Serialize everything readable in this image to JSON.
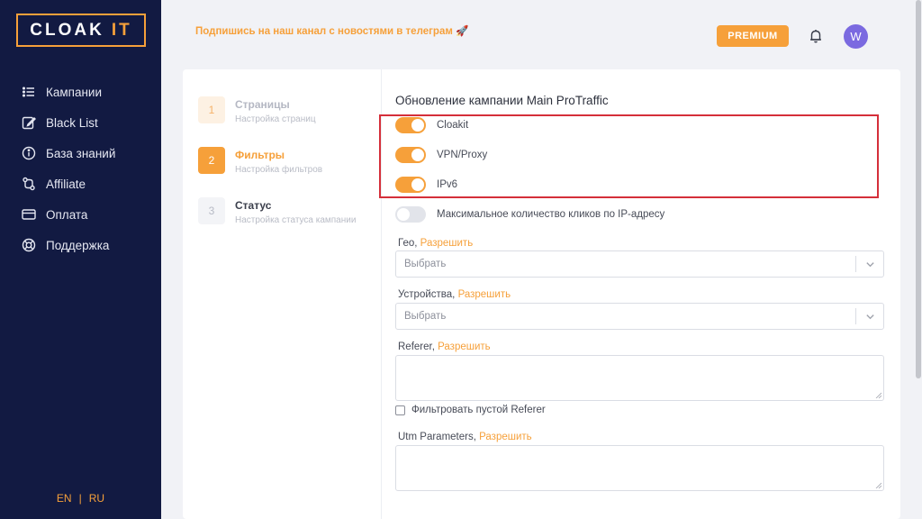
{
  "brand": {
    "logo_main": "CLOAK",
    "logo_accent": "IT"
  },
  "sidebar": {
    "items": [
      {
        "label": "Кампании",
        "icon": "list-icon"
      },
      {
        "label": "Black List",
        "icon": "edit-icon"
      },
      {
        "label": "База знаний",
        "icon": "info-icon"
      },
      {
        "label": "Affiliate",
        "icon": "affiliate-icon"
      },
      {
        "label": "Оплата",
        "icon": "credit-card-icon"
      },
      {
        "label": "Поддержка",
        "icon": "lifebuoy-icon"
      }
    ],
    "lang": {
      "en": "EN",
      "sep": "|",
      "ru": "RU"
    }
  },
  "header": {
    "promo_text": "Подпишись на наш канал с новостями в телеграм 🚀",
    "premium_label": "PREMIUM",
    "avatar_letter": "W"
  },
  "steps": [
    {
      "num": "1",
      "title": "Страницы",
      "subtitle": "Настройка страниц",
      "state": "done"
    },
    {
      "num": "2",
      "title": "Фильтры",
      "subtitle": "Настройка фильтров",
      "state": "active"
    },
    {
      "num": "3",
      "title": "Статус",
      "subtitle": "Настройка статуса кампании",
      "state": "pending"
    }
  ],
  "form": {
    "title": "Обновление кампании Main ProTraffic",
    "toggles": [
      {
        "label": "Cloakit",
        "on": true
      },
      {
        "label": "VPN/Proxy",
        "on": true
      },
      {
        "label": "IPv6",
        "on": true
      },
      {
        "label": "Максимальное количество кликов по IP-адресу",
        "on": false
      }
    ],
    "geo": {
      "label": "Гео,",
      "link": "Разрешить",
      "value": "Выбрать"
    },
    "devices": {
      "label": "Устройства,",
      "link": "Разрешить",
      "value": "Выбрать"
    },
    "referer": {
      "label": "Referer,",
      "link": "Разрешить",
      "value": ""
    },
    "empty_referer": {
      "label": "Фильтровать пустой Referer",
      "checked": false
    },
    "utm": {
      "label": "Utm Parameters,",
      "link": "Разрешить",
      "value": ""
    }
  },
  "colors": {
    "accent": "#f6a03a",
    "sidebar": "#121a42",
    "highlight": "#d52f3a"
  }
}
